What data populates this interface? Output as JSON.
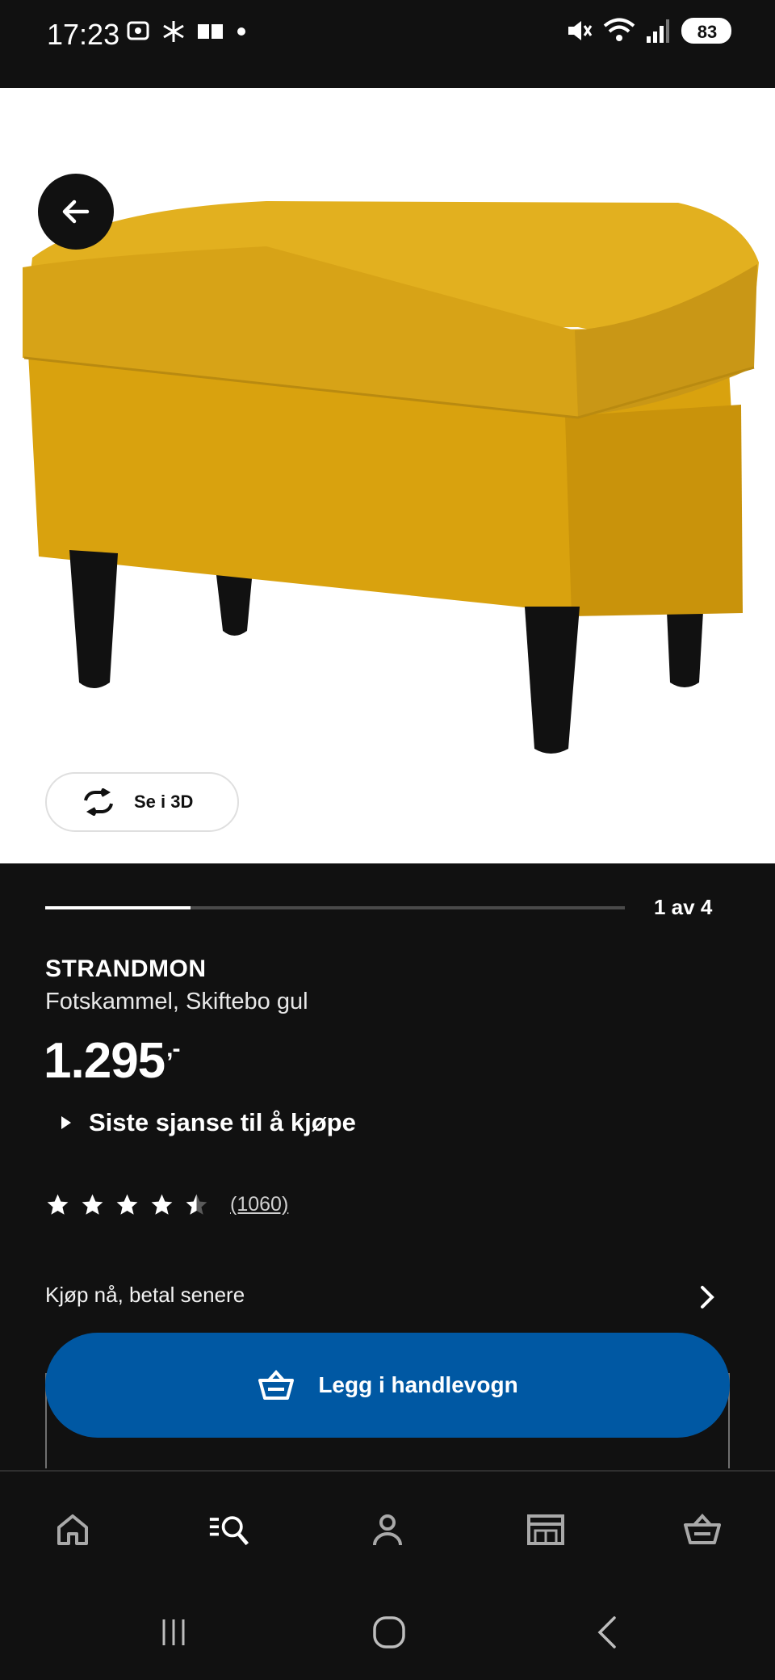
{
  "status_bar": {
    "time": "17:23",
    "left_icons": [
      "screenshot-icon",
      "snowflake-icon",
      "cards-icon",
      "dot-icon"
    ],
    "right_icons": [
      "mute-icon",
      "wifi-icon",
      "signal-icon",
      "battery-icon"
    ]
  },
  "hero": {
    "back_icon": "arrow-left-icon",
    "view_3d_label": "Se i 3D",
    "view_3d_icon": "rotate-icon"
  },
  "gallery": {
    "counter": "1 av 4",
    "progress_fraction": 0.25
  },
  "product": {
    "name": "STRANDMON",
    "description": "Fotskammel, Skiftebo gul",
    "price": "1.295",
    "price_suffix": ",-",
    "last_chance": "Siste sjanse til å kjøpe",
    "rating": 4.5,
    "max_rating": 5,
    "review_count": "(1060)"
  },
  "pay_later": {
    "label": "Kjøp nå, betal senere"
  },
  "add_to_cart": {
    "label": "Legg i handlevogn",
    "color": "#0058a3"
  },
  "tabbar": {
    "items": [
      "home-icon",
      "search-list-icon",
      "profile-icon",
      "store-icon",
      "cart-icon"
    ]
  },
  "system_nav": [
    "recents-icon",
    "home-circle-icon",
    "back-chevron-icon"
  ]
}
